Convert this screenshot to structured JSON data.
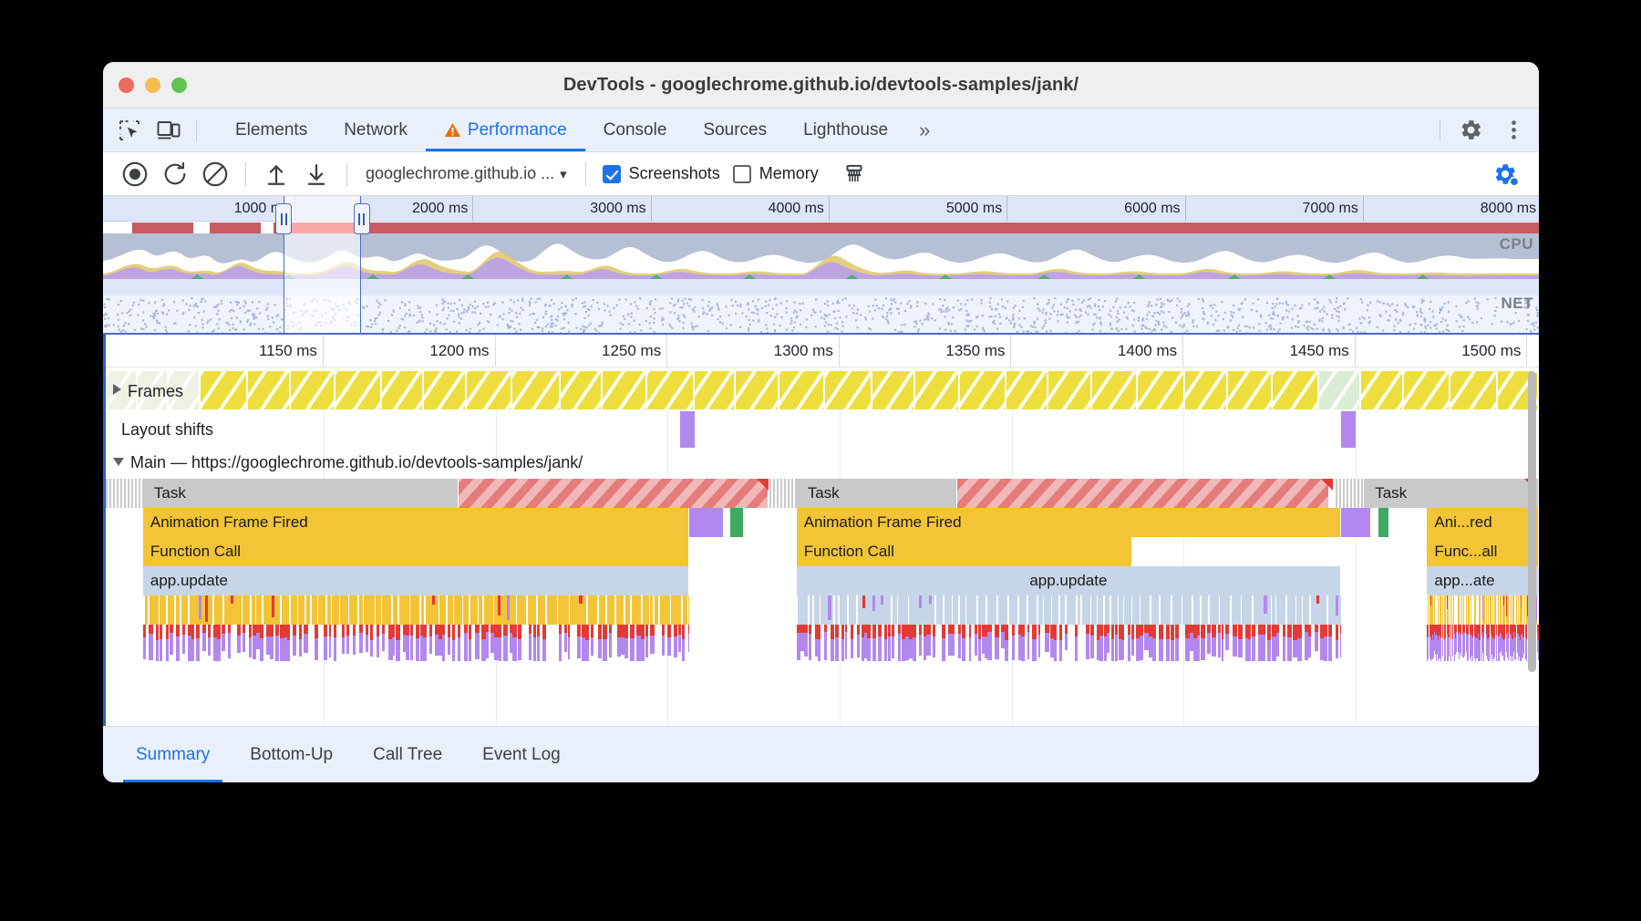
{
  "window": {
    "title": "DevTools - googlechrome.github.io/devtools-samples/jank/",
    "traffic_lights": [
      "close",
      "minimize",
      "maximize"
    ]
  },
  "tabbar": {
    "icons": [
      "inspect-element-icon",
      "device-toolbar-icon"
    ],
    "tabs": [
      {
        "label": "Elements",
        "active": false,
        "warning": false
      },
      {
        "label": "Network",
        "active": false,
        "warning": false
      },
      {
        "label": "Performance",
        "active": true,
        "warning": true
      },
      {
        "label": "Console",
        "active": false,
        "warning": false
      },
      {
        "label": "Sources",
        "active": false,
        "warning": false
      },
      {
        "label": "Lighthouse",
        "active": false,
        "warning": false
      }
    ],
    "overflow_label": "»",
    "right_icons": [
      "gear-icon",
      "kebab-menu-icon"
    ]
  },
  "perf_toolbar": {
    "buttons": [
      "record-button",
      "reload-and-record-button",
      "clear-button",
      "load-profile-button",
      "save-profile-button"
    ],
    "target_select": {
      "value": "googlechrome.github.io ...",
      "caret": "▾"
    },
    "screenshots": {
      "label": "Screenshots",
      "checked": true
    },
    "memory": {
      "label": "Memory",
      "checked": false
    },
    "collect_garbage": "collect-garbage-icon",
    "settings": "capture-settings-icon"
  },
  "overview": {
    "ticks": [
      "1000 ms",
      "2000 ms",
      "3000 ms",
      "4000 ms",
      "5000 ms",
      "6000 ms",
      "7000 ms",
      "8000 ms"
    ],
    "track_labels": [
      "CPU",
      "NET"
    ],
    "selection": {
      "start_pct": 12.6,
      "end_pct": 18.0
    },
    "handles": [
      "selection-left-handle",
      "selection-right-handle"
    ]
  },
  "flame": {
    "ticks": [
      "1150 ms",
      "1200 ms",
      "1250 ms",
      "1300 ms",
      "1350 ms",
      "1400 ms",
      "1450 ms",
      "1500 ms"
    ],
    "tracks": [
      {
        "name": "Frames",
        "label": "Frames",
        "expander": "right"
      },
      {
        "name": "Layout shifts",
        "label": "Layout shifts",
        "expander": "none"
      },
      {
        "name": "Main",
        "label": "Main — https://googlechrome.github.io/devtools-samples/jank/",
        "expander": "down"
      }
    ],
    "events": {
      "task": "Task",
      "animation_frame_fired": "Animation Frame Fired",
      "function_call": "Function Call",
      "app_update": "app.update",
      "animation_frame_fired_short": "Ani...red",
      "function_call_short": "Func...all",
      "app_update_short": "app...ate"
    }
  },
  "bottom_tabs": [
    {
      "label": "Summary",
      "active": true
    },
    {
      "label": "Bottom-Up",
      "active": false
    },
    {
      "label": "Call Tree",
      "active": false
    },
    {
      "label": "Event Log",
      "active": false
    }
  ],
  "colors": {
    "accent": "#1a73e8",
    "frame_yellow": "#edde3e",
    "event_yellow": "#f2c436",
    "event_blue": "#c6d6e8",
    "purple": "#b388ee",
    "red": "#e53935",
    "frames_bar": "#c75c62"
  }
}
